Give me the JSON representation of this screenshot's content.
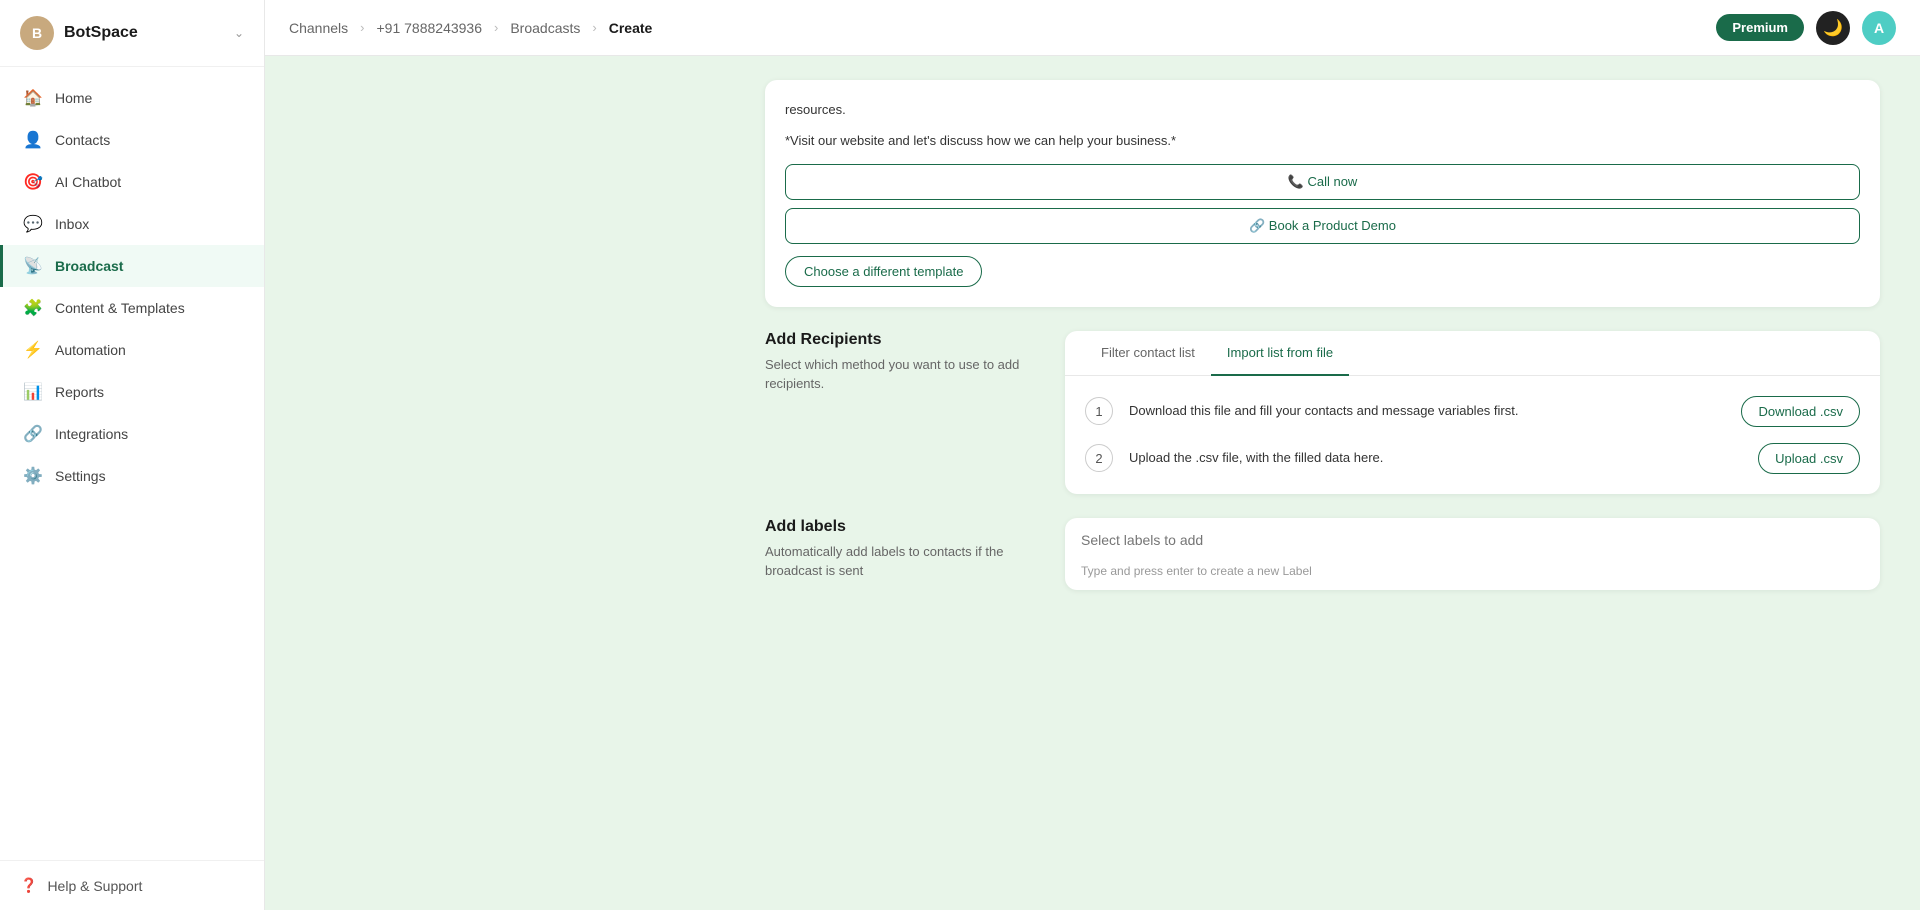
{
  "brand": {
    "initial": "B",
    "name": "BotSpace",
    "chevron": "⌃"
  },
  "topbar": {
    "premium_label": "Premium",
    "user_initial": "A",
    "breadcrumbs": [
      {
        "label": "Channels",
        "active": false
      },
      {
        "label": "+91 7888243936",
        "active": false
      },
      {
        "label": "Broadcasts",
        "active": false
      },
      {
        "label": "Create",
        "active": true
      }
    ]
  },
  "nav": [
    {
      "id": "home",
      "icon": "🏠",
      "label": "Home",
      "active": false
    },
    {
      "id": "contacts",
      "icon": "👤",
      "label": "Contacts",
      "active": false
    },
    {
      "id": "ai-chatbot",
      "icon": "🎯",
      "label": "AI Chatbot",
      "active": false
    },
    {
      "id": "inbox",
      "icon": "💬",
      "label": "Inbox",
      "active": false
    },
    {
      "id": "broadcast",
      "icon": "📡",
      "label": "Broadcast",
      "active": true
    },
    {
      "id": "content-templates",
      "icon": "🧩",
      "label": "Content & Templates",
      "active": false
    },
    {
      "id": "automation",
      "icon": "⚡",
      "label": "Automation",
      "active": false
    },
    {
      "id": "reports",
      "icon": "📊",
      "label": "Reports",
      "active": false
    },
    {
      "id": "integrations",
      "icon": "🔗",
      "label": "Integrations",
      "active": false
    },
    {
      "id": "settings",
      "icon": "⚙️",
      "label": "Settings",
      "active": false
    }
  ],
  "footer": {
    "icon": "❓",
    "label": "Help & Support"
  },
  "template_section": {
    "text1": "resources.",
    "text2": "*Visit our website and let's discuss how we can help your business.*",
    "call_now_label": "📞 Call now",
    "book_demo_label": "🔗 Book a Product Demo",
    "choose_template_label": "Choose a different template"
  },
  "recipients_section": {
    "title": "Add Recipients",
    "description": "Select which method you want to use to add recipients.",
    "tabs": [
      {
        "label": "Filter contact list",
        "active": false
      },
      {
        "label": "Import list from file",
        "active": true
      }
    ],
    "steps": [
      {
        "num": "1",
        "text": "Download this file and fill your contacts and message variables first.",
        "btn_label": "Download .csv"
      },
      {
        "num": "2",
        "text": "Upload the .csv file, with the filled data here.",
        "btn_label": "Upload .csv"
      }
    ]
  },
  "labels_section": {
    "title": "Add labels",
    "description": "Automatically add labels to contacts if the broadcast is sent",
    "input_placeholder": "Select labels to add",
    "hint": "Type and press enter to create a new Label"
  }
}
